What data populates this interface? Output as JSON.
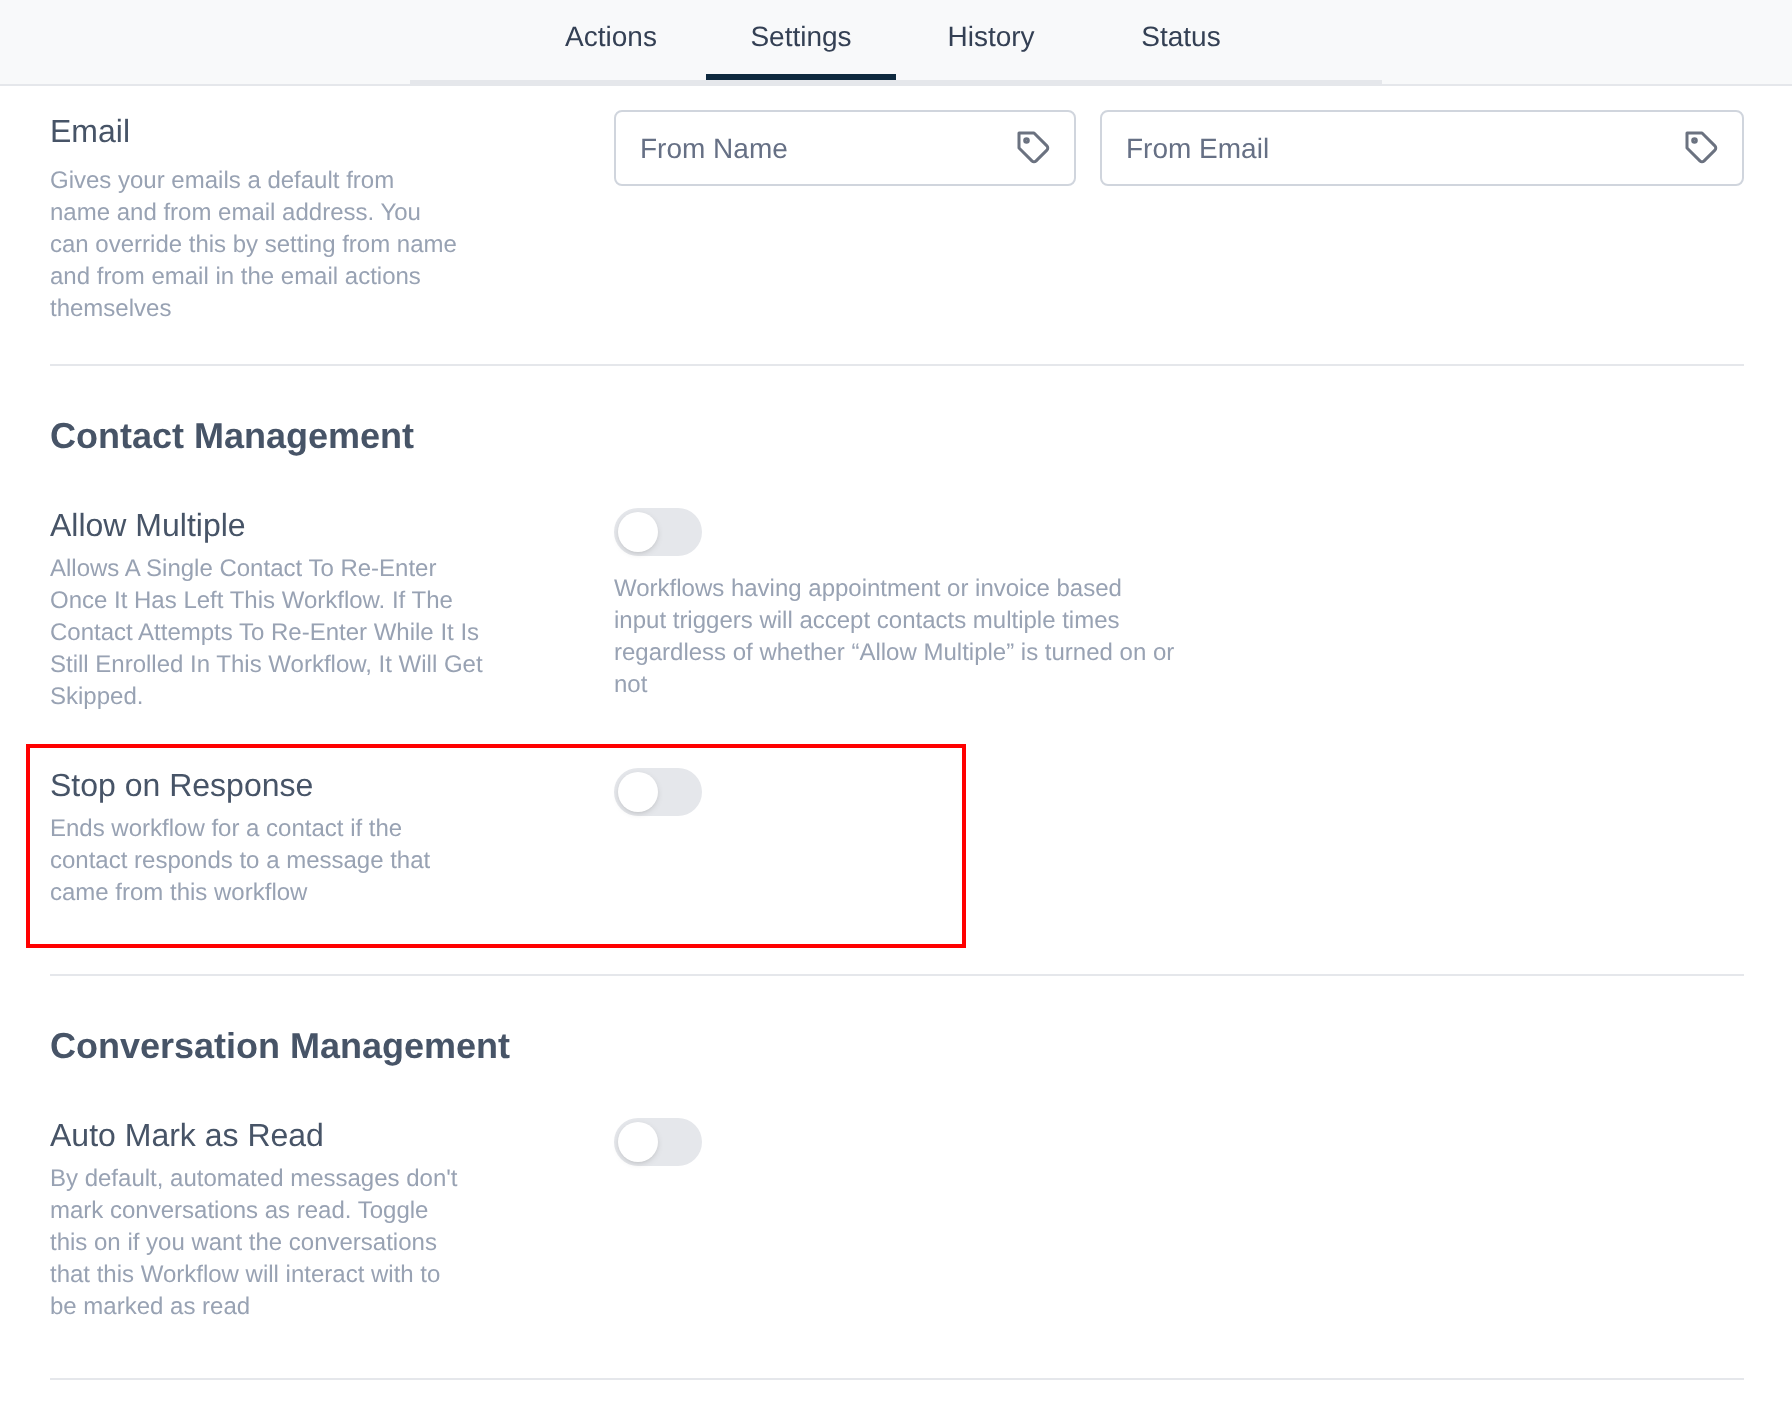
{
  "tabs": [
    {
      "label": "Actions",
      "selected": false
    },
    {
      "label": "Settings",
      "selected": true
    },
    {
      "label": "History",
      "selected": false
    },
    {
      "label": "Status",
      "selected": false
    }
  ],
  "email": {
    "title": "Email",
    "description": "Gives your emails a default from name and from email address. You can override this by setting from name and from email in the email actions themselves",
    "fields": [
      {
        "placeholder": "From Name"
      },
      {
        "placeholder": "From Email"
      }
    ]
  },
  "sections": [
    {
      "heading": "Contact Management",
      "settings": [
        {
          "title": "Allow Multiple",
          "description": "Allows A Single Contact To Re-Enter Once It Has Left This Workflow. If The Contact Attempts To Re-Enter While It Is Still Enrolled In This Workflow, It Will Get Skipped.",
          "on": false,
          "highlighted": false,
          "note": "Workflows having appointment or invoice based input triggers will accept contacts multiple times regardless of whether “Allow Multiple” is turned on or not"
        },
        {
          "title": "Stop on Response",
          "description": "Ends workflow for a contact if the contact responds to a message that came from this workflow",
          "on": false,
          "highlighted": true
        }
      ]
    },
    {
      "heading": "Conversation Management",
      "settings": [
        {
          "title": "Auto Mark as Read",
          "description": "By default, automated messages don't mark conversations as read. Toggle this on if you want the conversations that this Workflow will interact with to be marked as read",
          "on": false,
          "highlighted": false
        }
      ]
    }
  ]
}
